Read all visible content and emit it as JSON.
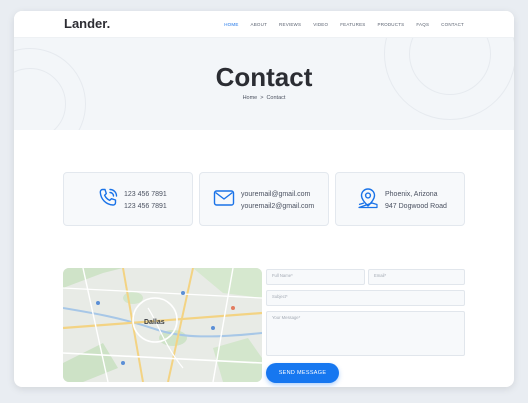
{
  "brand": {
    "logo": "Lander."
  },
  "nav": {
    "items": [
      "HOME",
      "ABOUT",
      "REVIEWS",
      "VIDEO",
      "FEATURES",
      "PRODUCTS",
      "FAQS",
      "CONTACT"
    ],
    "active_index": 0
  },
  "hero": {
    "title": "Contact",
    "breadcrumb": {
      "home": "Home",
      "separator": ">",
      "current": "Contact"
    }
  },
  "contact_cards": [
    {
      "icon": "phone-icon",
      "lines": [
        "123 456 7891",
        "123 456 7891"
      ]
    },
    {
      "icon": "mail-icon",
      "lines": [
        "youremail@gmail.com",
        "youremail2@gmail.com"
      ]
    },
    {
      "icon": "location-pin-icon",
      "lines": [
        "Phoenix, Arizona",
        "947 Dogwood Road"
      ]
    }
  ],
  "map": {
    "label": "Dallas"
  },
  "form": {
    "full_name_placeholder": "Full Name*",
    "email_placeholder": "Email*",
    "subject_placeholder": "Subject*",
    "message_placeholder": "Your Message*",
    "submit_label": "SEND MESSAGE"
  },
  "colors": {
    "accent": "#1677f0",
    "icon_blue": "#1a73e8",
    "hero_bg": "#f3f6f9"
  }
}
